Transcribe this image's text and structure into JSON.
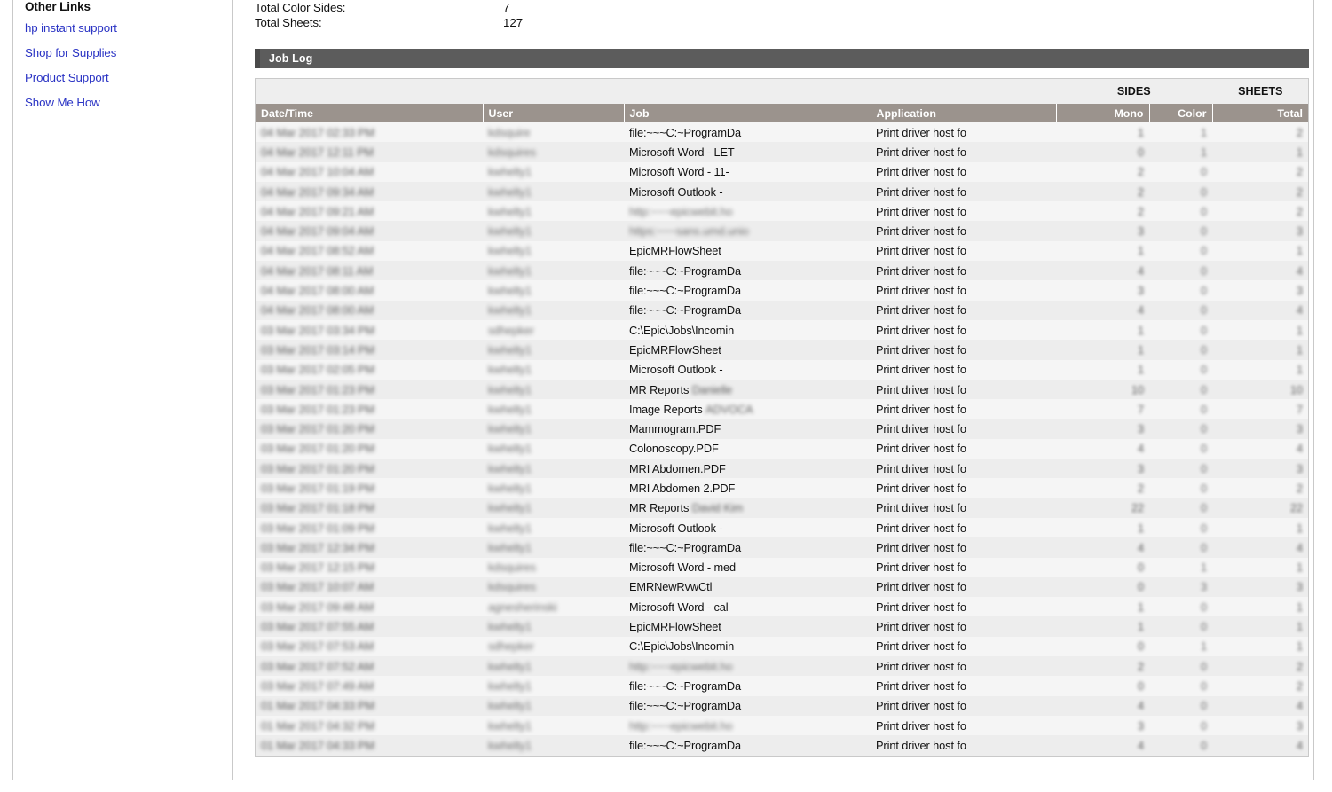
{
  "sidebar": {
    "heading": "Other Links",
    "links": [
      {
        "label": "hp instant support"
      },
      {
        "label": "Shop for Supplies"
      },
      {
        "label": "Product Support"
      },
      {
        "label": "Show Me How"
      }
    ]
  },
  "summary": {
    "rows": [
      {
        "label": "Total Color Sides:",
        "value": "7"
      },
      {
        "label": "Total Sheets:",
        "value": "127"
      }
    ]
  },
  "section": {
    "title": "Job Log"
  },
  "table": {
    "group_headers": {
      "sides": "SIDES",
      "sheets": "SHEETS"
    },
    "columns": [
      {
        "key": "datetime",
        "label": "Date/Time"
      },
      {
        "key": "user",
        "label": "User"
      },
      {
        "key": "job",
        "label": "Job"
      },
      {
        "key": "application",
        "label": "Application"
      },
      {
        "key": "mono",
        "label": "Mono"
      },
      {
        "key": "color",
        "label": "Color"
      },
      {
        "key": "total",
        "label": "Total"
      }
    ],
    "rows": [
      {
        "datetime": "04 Mar 2017 02:33 PM",
        "datetime_redacted": true,
        "user": "kdsquire",
        "user_redacted": true,
        "job": "file:~~~C:~ProgramDa",
        "job_redacted": false,
        "application": "Print driver host fo",
        "mono": "1",
        "color": "1",
        "total": "2",
        "nums_redacted": true
      },
      {
        "datetime": "04 Mar 2017 12:11 PM",
        "datetime_redacted": true,
        "user": "kdsquires",
        "user_redacted": true,
        "job": "Microsoft Word - LET",
        "job_redacted": false,
        "application": "Print driver host fo",
        "mono": "0",
        "color": "1",
        "total": "1",
        "nums_redacted": true
      },
      {
        "datetime": "04 Mar 2017 10:04 AM",
        "datetime_redacted": true,
        "user": "kwhelty1",
        "user_redacted": true,
        "job": "Microsoft Word - 11-",
        "job_redacted": false,
        "application": "Print driver host fo",
        "mono": "2",
        "color": "0",
        "total": "2",
        "nums_redacted": true
      },
      {
        "datetime": "04 Mar 2017 09:34 AM",
        "datetime_redacted": true,
        "user": "kwhelty1",
        "user_redacted": true,
        "job": "Microsoft Outlook -",
        "job_redacted": false,
        "application": "Print driver host fo",
        "mono": "2",
        "color": "0",
        "total": "2",
        "nums_redacted": true
      },
      {
        "datetime": "04 Mar 2017 09:21 AM",
        "datetime_redacted": true,
        "user": "kwhelty1",
        "user_redacted": true,
        "job": "http:~~~epicwebit.ho",
        "job_redacted": true,
        "application": "Print driver host fo",
        "mono": "2",
        "color": "0",
        "total": "2",
        "nums_redacted": true
      },
      {
        "datetime": "04 Mar 2017 09:04 AM",
        "datetime_redacted": true,
        "user": "kwhelty1",
        "user_redacted": true,
        "job": "https:~~~sans.umd.unio",
        "job_redacted": true,
        "application": "Print driver host fo",
        "mono": "3",
        "color": "0",
        "total": "3",
        "nums_redacted": true
      },
      {
        "datetime": "04 Mar 2017 08:52 AM",
        "datetime_redacted": true,
        "user": "kwhelty1",
        "user_redacted": true,
        "job": "EpicMRFlowSheet",
        "job_redacted": false,
        "application": "Print driver host fo",
        "mono": "1",
        "color": "0",
        "total": "1",
        "nums_redacted": true
      },
      {
        "datetime": "04 Mar 2017 08:11 AM",
        "datetime_redacted": true,
        "user": "kwhelty1",
        "user_redacted": true,
        "job": "file:~~~C:~ProgramDa",
        "job_redacted": false,
        "application": "Print driver host fo",
        "mono": "4",
        "color": "0",
        "total": "4",
        "nums_redacted": true
      },
      {
        "datetime": "04 Mar 2017 08:00 AM",
        "datetime_redacted": true,
        "user": "kwhelty1",
        "user_redacted": true,
        "job": "file:~~~C:~ProgramDa",
        "job_redacted": false,
        "application": "Print driver host fo",
        "mono": "3",
        "color": "0",
        "total": "3",
        "nums_redacted": true
      },
      {
        "datetime": "04 Mar 2017 08:00 AM",
        "datetime_redacted": true,
        "user": "kwhelty1",
        "user_redacted": true,
        "job": "file:~~~C:~ProgramDa",
        "job_redacted": false,
        "application": "Print driver host fo",
        "mono": "4",
        "color": "0",
        "total": "4",
        "nums_redacted": true
      },
      {
        "datetime": "03 Mar 2017 03:34 PM",
        "datetime_redacted": true,
        "user": "sdhepker",
        "user_redacted": true,
        "job": "C:\\Epic\\Jobs\\Incomin",
        "job_redacted": false,
        "application": "Print driver host fo",
        "mono": "1",
        "color": "0",
        "total": "1",
        "nums_redacted": true
      },
      {
        "datetime": "03 Mar 2017 03:14 PM",
        "datetime_redacted": true,
        "user": "kwhelty1",
        "user_redacted": true,
        "job": "EpicMRFlowSheet",
        "job_redacted": false,
        "application": "Print driver host fo",
        "mono": "1",
        "color": "0",
        "total": "1",
        "nums_redacted": true
      },
      {
        "datetime": "03 Mar 2017 02:05 PM",
        "datetime_redacted": true,
        "user": "kwhelty1",
        "user_redacted": true,
        "job": "Microsoft Outlook -",
        "job_redacted": false,
        "application": "Print driver host fo",
        "mono": "1",
        "color": "0",
        "total": "1",
        "nums_redacted": true
      },
      {
        "datetime": "03 Mar 2017 01:23 PM",
        "datetime_redacted": true,
        "user": "kwhelty1",
        "user_redacted": true,
        "job": "MR Reports Danielle",
        "job_redacted": false,
        "job_suffix_redacted": true,
        "job_prefix": "MR Reports ",
        "job_suffix": "Danielle",
        "application": "Print driver host fo",
        "mono": "10",
        "color": "0",
        "total": "10",
        "nums_redacted": true
      },
      {
        "datetime": "03 Mar 2017 01:23 PM",
        "datetime_redacted": true,
        "user": "kwhelty1",
        "user_redacted": true,
        "job": "Image Reports ADVOCA",
        "job_redacted": false,
        "job_suffix_redacted": true,
        "job_prefix": "Image Reports ",
        "job_suffix": "ADVOCA",
        "application": "Print driver host fo",
        "mono": "7",
        "color": "0",
        "total": "7",
        "nums_redacted": true
      },
      {
        "datetime": "03 Mar 2017 01:20 PM",
        "datetime_redacted": true,
        "user": "kwhelty1",
        "user_redacted": true,
        "job": "Mammogram.PDF",
        "job_redacted": false,
        "application": "Print driver host fo",
        "mono": "3",
        "color": "0",
        "total": "3",
        "nums_redacted": true
      },
      {
        "datetime": "03 Mar 2017 01:20 PM",
        "datetime_redacted": true,
        "user": "kwhelty1",
        "user_redacted": true,
        "job": "Colonoscopy.PDF",
        "job_redacted": false,
        "application": "Print driver host fo",
        "mono": "4",
        "color": "0",
        "total": "4",
        "nums_redacted": true
      },
      {
        "datetime": "03 Mar 2017 01:20 PM",
        "datetime_redacted": true,
        "user": "kwhelty1",
        "user_redacted": true,
        "job": "MRI Abdomen.PDF",
        "job_redacted": false,
        "application": "Print driver host fo",
        "mono": "3",
        "color": "0",
        "total": "3",
        "nums_redacted": true
      },
      {
        "datetime": "03 Mar 2017 01:19 PM",
        "datetime_redacted": true,
        "user": "kwhelty1",
        "user_redacted": true,
        "job": "MRI Abdomen 2.PDF",
        "job_redacted": false,
        "application": "Print driver host fo",
        "mono": "2",
        "color": "0",
        "total": "2",
        "nums_redacted": true
      },
      {
        "datetime": "03 Mar 2017 01:18 PM",
        "datetime_redacted": true,
        "user": "kwhelty1",
        "user_redacted": true,
        "job": "MR Reports David Kim",
        "job_redacted": false,
        "job_suffix_redacted": true,
        "job_prefix": "MR Reports ",
        "job_suffix": "David Kim",
        "application": "Print driver host fo",
        "mono": "22",
        "color": "0",
        "total": "22",
        "nums_redacted": true
      },
      {
        "datetime": "03 Mar 2017 01:09 PM",
        "datetime_redacted": true,
        "user": "kwhelty1",
        "user_redacted": true,
        "job": "Microsoft Outlook -",
        "job_redacted": false,
        "application": "Print driver host fo",
        "mono": "1",
        "color": "0",
        "total": "1",
        "nums_redacted": true
      },
      {
        "datetime": "03 Mar 2017 12:34 PM",
        "datetime_redacted": true,
        "user": "kwhelty1",
        "user_redacted": true,
        "job": "file:~~~C:~ProgramDa",
        "job_redacted": false,
        "application": "Print driver host fo",
        "mono": "4",
        "color": "0",
        "total": "4",
        "nums_redacted": true
      },
      {
        "datetime": "03 Mar 2017 12:15 PM",
        "datetime_redacted": true,
        "user": "kdsquires",
        "user_redacted": true,
        "job": "Microsoft Word - med",
        "job_redacted": false,
        "application": "Print driver host fo",
        "mono": "0",
        "color": "1",
        "total": "1",
        "nums_redacted": true
      },
      {
        "datetime": "03 Mar 2017 10:07 AM",
        "datetime_redacted": true,
        "user": "kdsquires",
        "user_redacted": true,
        "job": "EMRNewRvwCtl",
        "job_redacted": false,
        "application": "Print driver host fo",
        "mono": "0",
        "color": "3",
        "total": "3",
        "nums_redacted": true
      },
      {
        "datetime": "03 Mar 2017 09:48 AM",
        "datetime_redacted": true,
        "user": "agnesherinski",
        "user_redacted": true,
        "job": "Microsoft Word - cal",
        "job_redacted": false,
        "application": "Print driver host fo",
        "mono": "1",
        "color": "0",
        "total": "1",
        "nums_redacted": true
      },
      {
        "datetime": "03 Mar 2017 07:55 AM",
        "datetime_redacted": true,
        "user": "kwhelty1",
        "user_redacted": true,
        "job": "EpicMRFlowSheet",
        "job_redacted": false,
        "application": "Print driver host fo",
        "mono": "1",
        "color": "0",
        "total": "1",
        "nums_redacted": true
      },
      {
        "datetime": "03 Mar 2017 07:53 AM",
        "datetime_redacted": true,
        "user": "sdhepker",
        "user_redacted": true,
        "job": "C:\\Epic\\Jobs\\Incomin",
        "job_redacted": false,
        "application": "Print driver host fo",
        "mono": "0",
        "color": "1",
        "total": "1",
        "nums_redacted": true
      },
      {
        "datetime": "03 Mar 2017 07:52 AM",
        "datetime_redacted": true,
        "user": "kwhelty1",
        "user_redacted": true,
        "job": "http:~~~epicwebit.ho",
        "job_redacted": true,
        "application": "Print driver host fo",
        "mono": "2",
        "color": "0",
        "total": "2",
        "nums_redacted": true
      },
      {
        "datetime": "03 Mar 2017 07:49 AM",
        "datetime_redacted": true,
        "user": "kwhelty1",
        "user_redacted": true,
        "job": "file:~~~C:~ProgramDa",
        "job_redacted": false,
        "application": "Print driver host fo",
        "mono": "0",
        "color": "0",
        "total": "2",
        "nums_redacted": true
      },
      {
        "datetime": "01 Mar 2017 04:33 PM",
        "datetime_redacted": true,
        "user": "kwhelty1",
        "user_redacted": true,
        "job": "file:~~~C:~ProgramDa",
        "job_redacted": false,
        "application": "Print driver host fo",
        "mono": "4",
        "color": "0",
        "total": "4",
        "nums_redacted": true
      },
      {
        "datetime": "01 Mar 2017 04:32 PM",
        "datetime_redacted": true,
        "user": "kwhelty1",
        "user_redacted": true,
        "job": "http:~~~epicwebit.ho",
        "job_redacted": true,
        "application": "Print driver host fo",
        "mono": "3",
        "color": "0",
        "total": "3",
        "nums_redacted": true
      },
      {
        "datetime": "01 Mar 2017 04:33 PM",
        "datetime_redacted": true,
        "user": "kwhelty1",
        "user_redacted": true,
        "job": "file:~~~C:~ProgramDa",
        "job_redacted": false,
        "application": "Print driver host fo",
        "mono": "4",
        "color": "0",
        "total": "4",
        "nums_redacted": true
      }
    ]
  },
  "colors": {
    "link": "#2a33c4",
    "section_bar": "#5c5c5c",
    "table_header": "#9b938d",
    "group_header": "#eeeeee",
    "row_odd": "#f5f5f5",
    "row_even": "#ededed"
  }
}
